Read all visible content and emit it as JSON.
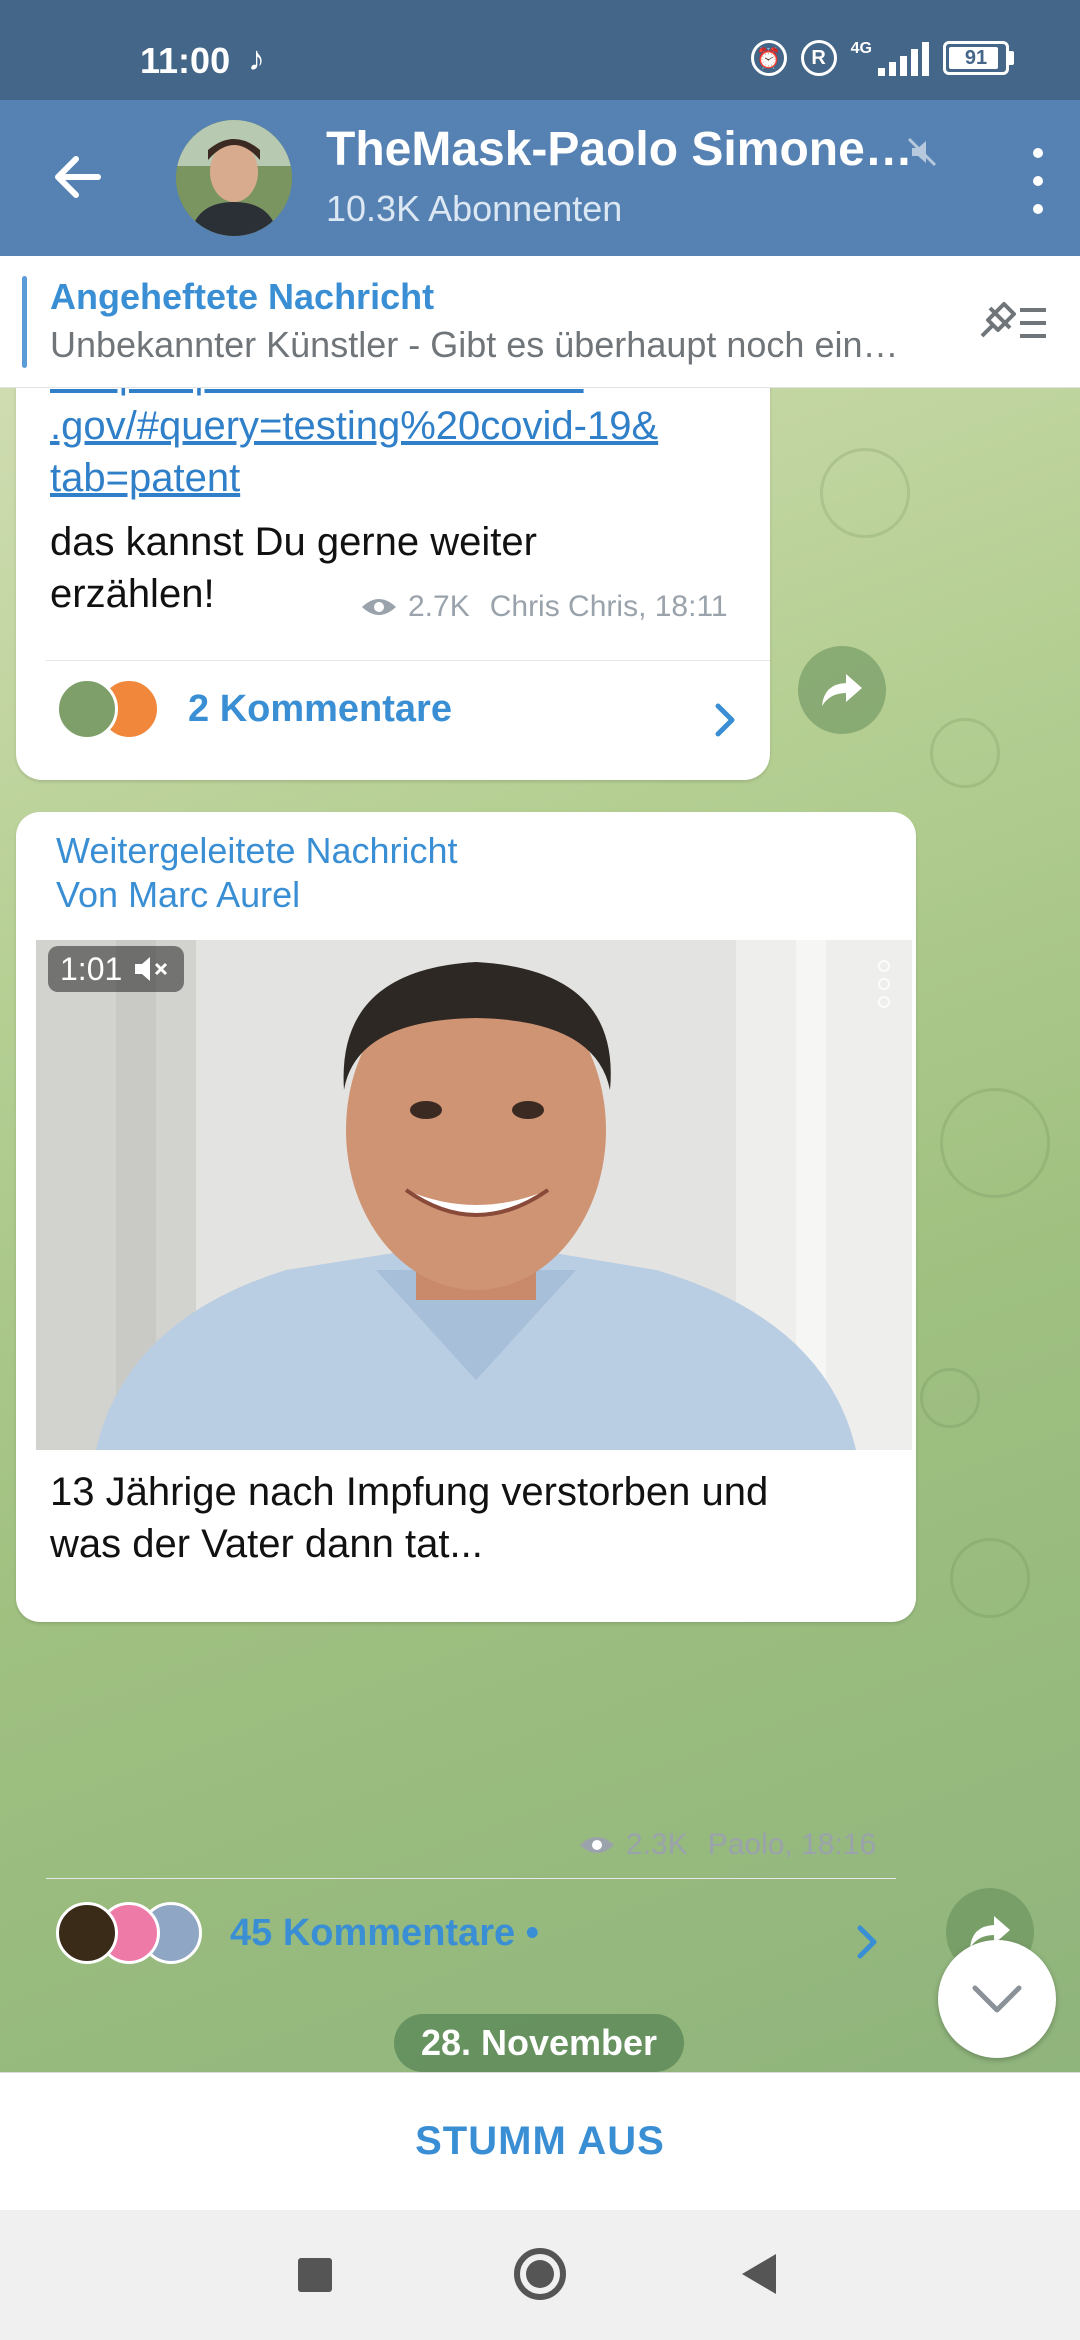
{
  "status_bar": {
    "time": "11:00",
    "network": "4G",
    "battery": "91",
    "battery_level": 0.91
  },
  "header": {
    "title": "TheMask-Paolo Simone…",
    "subtitle": "10.3K Abonnenten"
  },
  "pinned": {
    "title": "Angeheftete Nachricht",
    "text": "Unbekannter Künstler - Gibt es überhaupt noch ein…"
  },
  "message1": {
    "link_line1": "- https://pubchem.ncbi.nlm.nih",
    "link_line2": ".gov/#query=testing%20covid-19&",
    "link_line3": "tab=patent",
    "text_line1": "das kannst Du gerne weiter",
    "text_line2": "erzählen!",
    "views": "2.7K",
    "author_time": "Chris Chris, 18:11",
    "comments": "2 Kommentare"
  },
  "message2": {
    "forward_label": "Weitergeleitete Nachricht",
    "forward_from": "Von Marc Aurel",
    "video_duration": "1:01",
    "text_line1": "13 Jährige nach Impfung verstorben und",
    "text_line2": "was der Vater dann tat...",
    "views": "2.3K",
    "author_time": "Paolo, 18:16",
    "comments": "45 Kommentare •"
  },
  "date_separator": "28. November",
  "mute_button": "STUMM AUS",
  "colors": {
    "header": "#5682b3",
    "statusbar": "#446688",
    "accent": "#3a8fd4"
  },
  "icons": [
    "back-arrow-icon",
    "mute-icon",
    "more-icon",
    "pin-list-icon",
    "eye-icon",
    "chevron-right-icon",
    "forward-icon",
    "volume-off-icon",
    "chevron-down-icon"
  ]
}
